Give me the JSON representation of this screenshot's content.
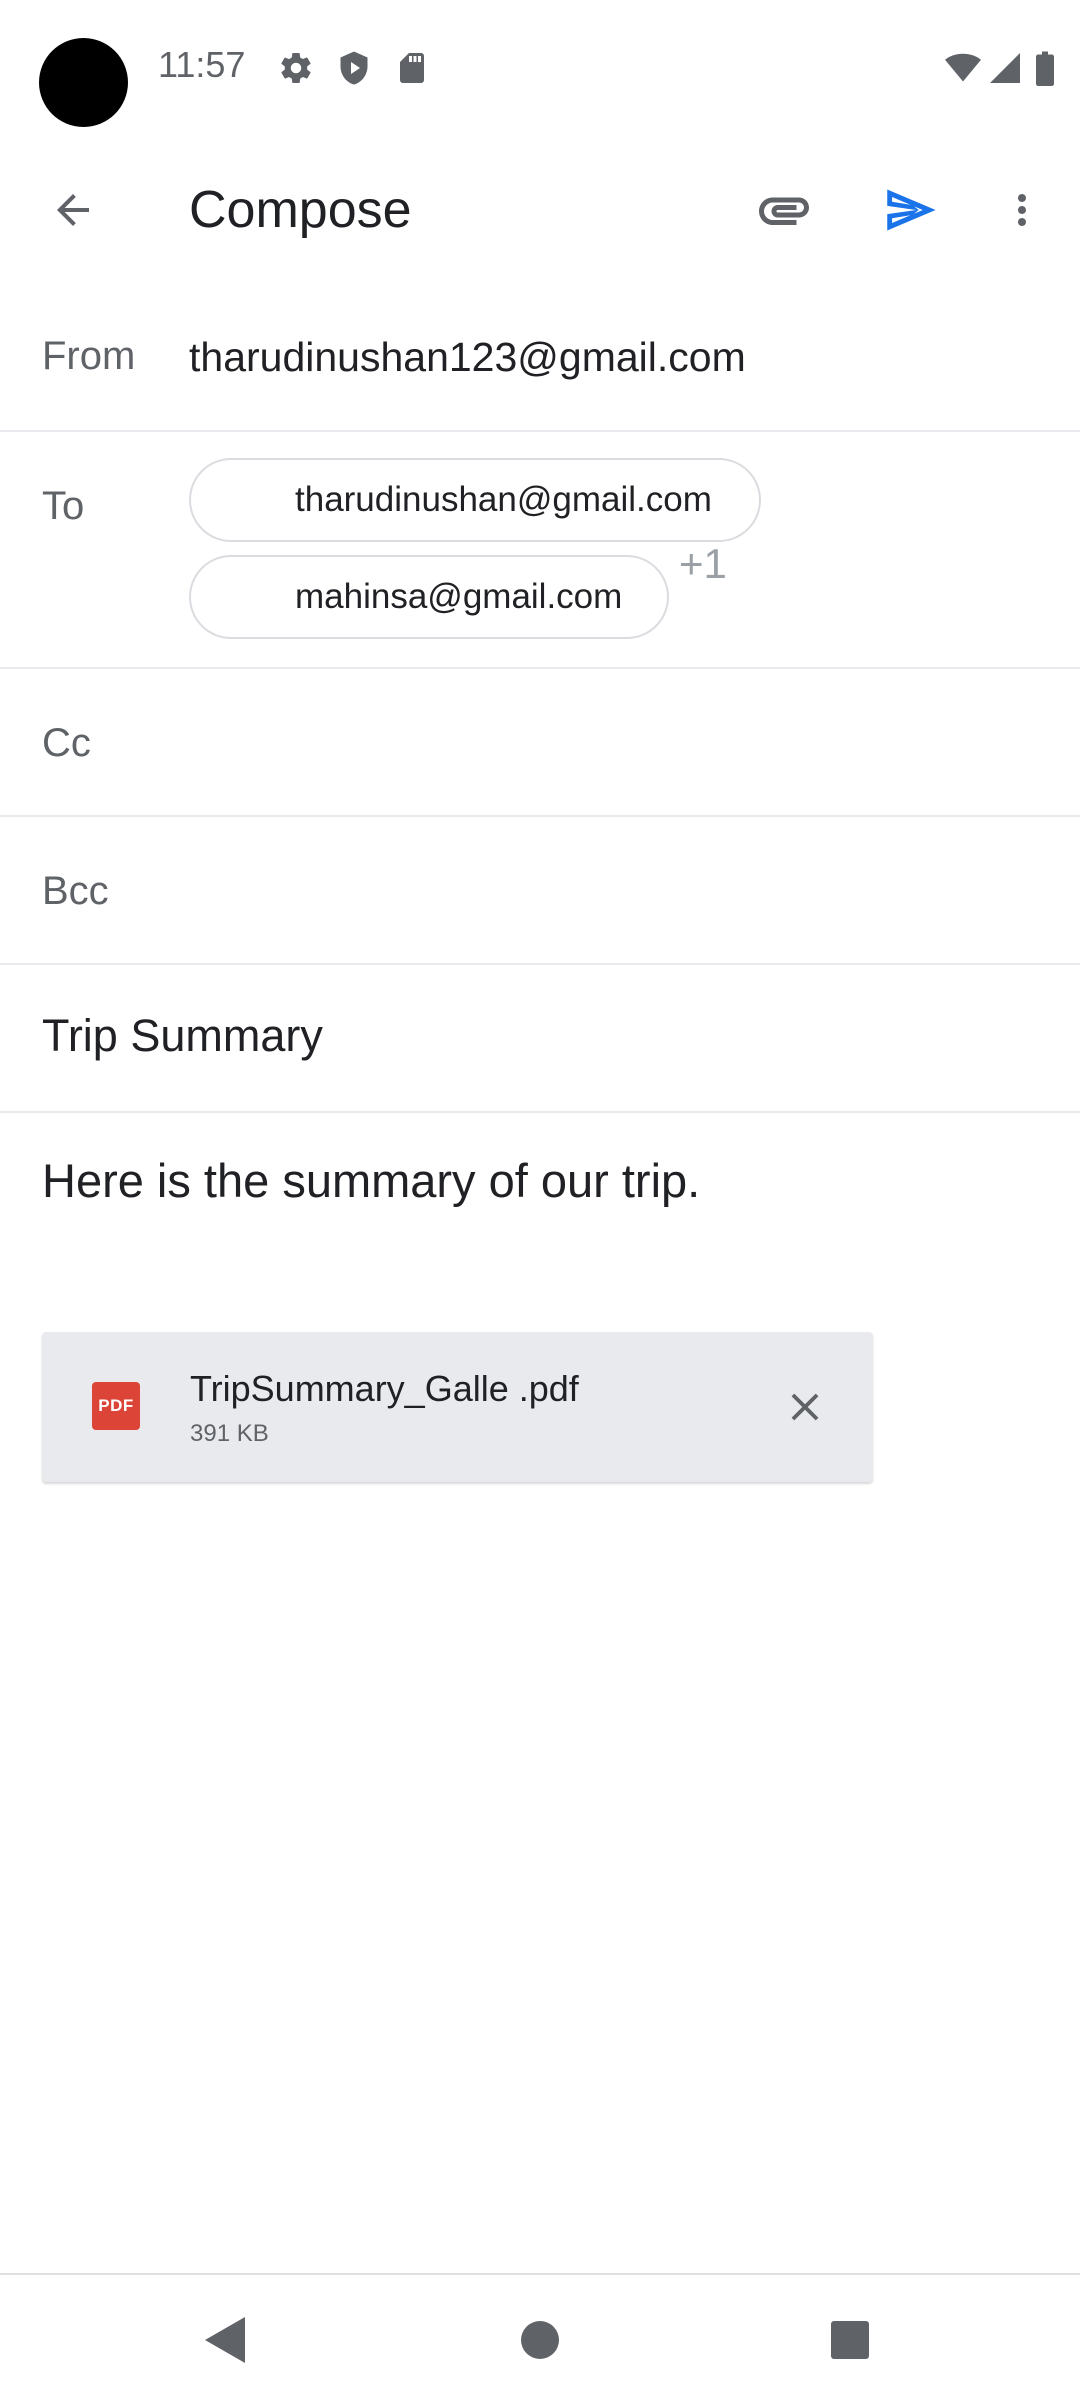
{
  "status_bar": {
    "time": "11:57",
    "left_icons": [
      "gear-icon",
      "shield-icon",
      "sd-card-icon"
    ],
    "right_icons": [
      "wifi-icon",
      "signal-icon",
      "battery-icon"
    ]
  },
  "app_bar": {
    "title": "Compose",
    "back_icon": "arrow-left-icon",
    "attach_icon": "paperclip-icon",
    "send_icon": "send-icon",
    "more_icon": "more-vert-icon",
    "send_color": "#1a73e8"
  },
  "compose": {
    "from_label": "From",
    "from_value": "tharudinushan123@gmail.com",
    "to_label": "To",
    "to_recipients": [
      "tharudinushan@gmail.com",
      "mahinsa@gmail.com"
    ],
    "to_more": "+1",
    "cc_label": "Cc",
    "bcc_label": "Bcc",
    "subject": "Trip Summary",
    "body": "Here is the summary of our trip."
  },
  "attachment": {
    "type_label": "PDF",
    "name": "TripSummary_Galle .pdf",
    "size": "391 KB",
    "badge_color": "#db4437"
  },
  "nav_bar": {
    "icons": [
      "back-triangle-icon",
      "home-circle-icon",
      "recents-square-icon"
    ]
  }
}
